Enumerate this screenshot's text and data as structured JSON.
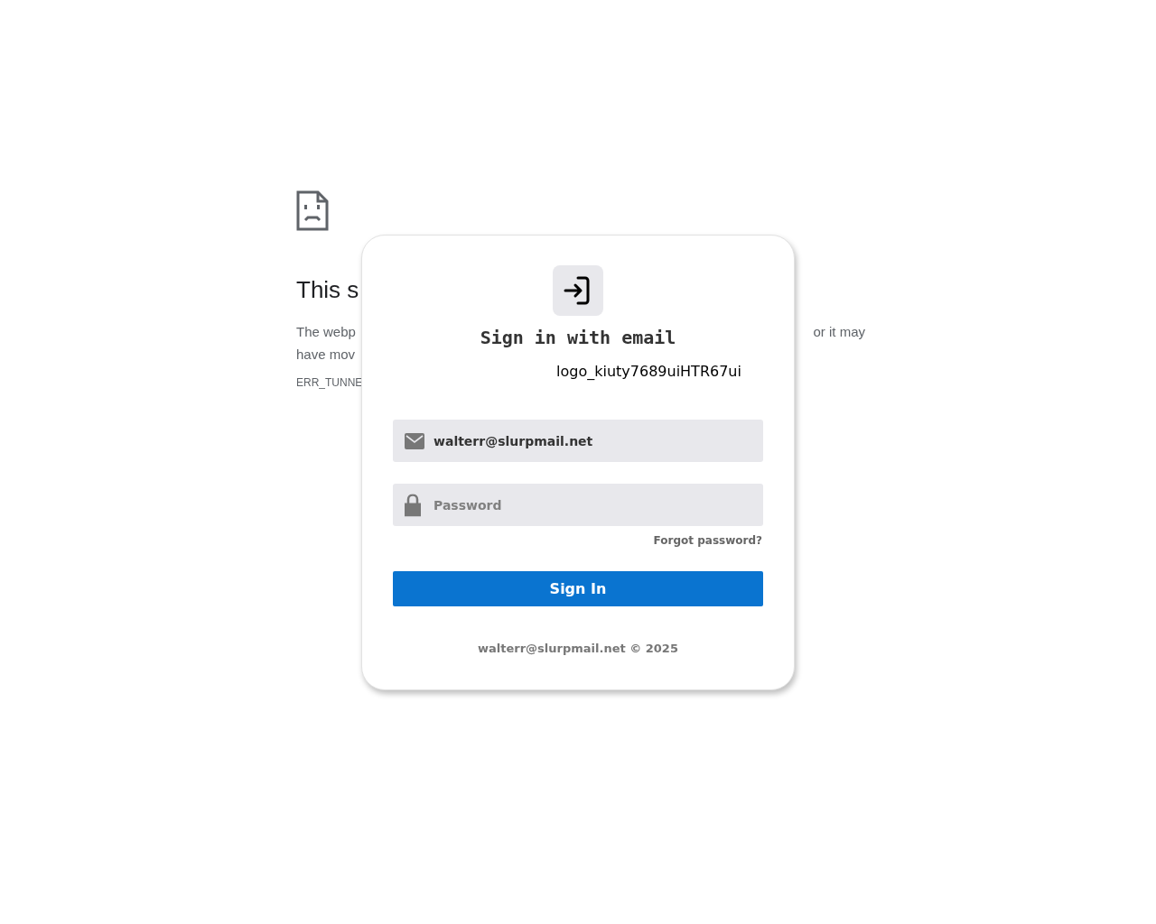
{
  "error_page": {
    "title": "This s",
    "text_left": [
      "The webp",
      "have mov"
    ],
    "text_right": [
      "or it may"
    ],
    "code": "ERR_TUNNE"
  },
  "card": {
    "heading": "Sign in with email",
    "logo_alt": "logo_kiuty7689uiHTR67ui",
    "fields": [
      {
        "kind": "email",
        "value": "walterr@slurpmail.net"
      },
      {
        "kind": "password",
        "placeholder": "Password"
      }
    ],
    "forgot_link": "Forgot password?",
    "button": "Sign In",
    "footer": "walterr@slurpmail.net © 2025"
  }
}
